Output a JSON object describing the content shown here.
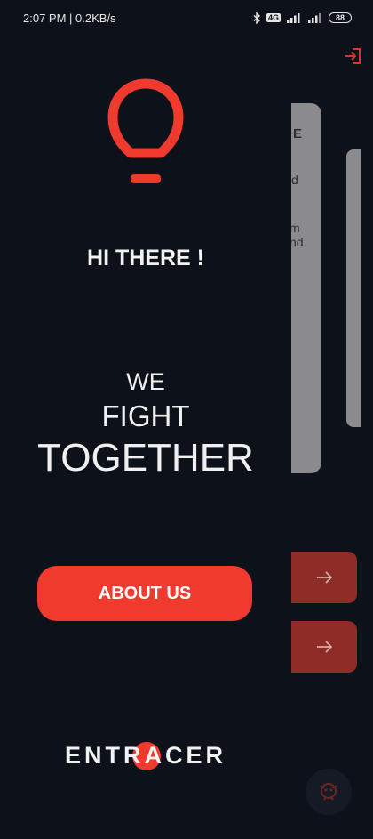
{
  "status_bar": {
    "time": "2:07 PM",
    "speed": "0.2KB/s",
    "network_badge": "4G",
    "battery": "88"
  },
  "drawer": {
    "greeting": "HI THERE !",
    "slogan": {
      "line1": "WE",
      "line2": "FIGHT",
      "line3": "TOGETHER"
    },
    "about_button_label": "ABOUT US",
    "brand": "ENTRACER"
  },
  "background_page": {
    "card_fragment_1": "E",
    "card_fragment_2": "d",
    "card_fragment_3a": "m",
    "card_fragment_3b": "nd"
  },
  "colors": {
    "background": "#0d1119",
    "accent": "#f03a2e",
    "dimmed_accent": "#8e2d27",
    "dimmed_card": "#8b8b8d"
  },
  "icons": {
    "logo": "lightbulb-icon",
    "logout": "logout-icon",
    "arrow": "arrow-right-icon",
    "fab": "mascot-icon"
  }
}
